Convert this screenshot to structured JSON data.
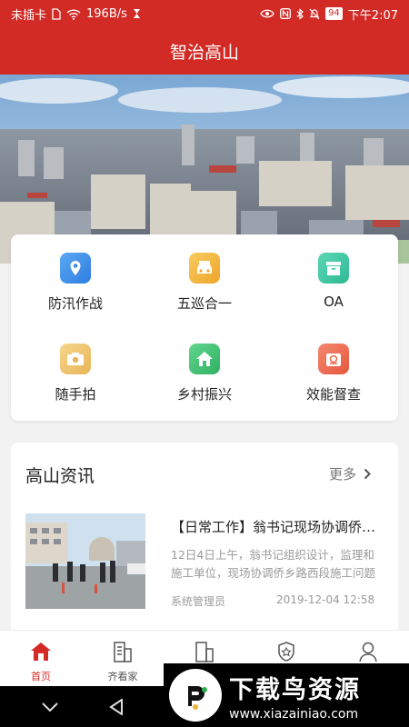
{
  "status_bar": {
    "carrier": "未插卡",
    "speed": "196B/s",
    "battery": "94",
    "time": "下午2:07"
  },
  "header": {
    "title": "智治高山"
  },
  "grid": [
    {
      "label": "防汛作战",
      "icon": "location-pin-icon",
      "color": "#3d8fe8"
    },
    {
      "label": "五巡合一",
      "icon": "car-icon",
      "color": "#f0b335"
    },
    {
      "label": "OA",
      "icon": "archive-box-icon",
      "color": "#37c4a3"
    },
    {
      "label": "随手拍",
      "icon": "camera-icon",
      "color": "#efc46a"
    },
    {
      "label": "乡村振兴",
      "icon": "home-icon",
      "color": "#3fc277"
    },
    {
      "label": "效能督查",
      "icon": "inspect-icon",
      "color": "#ef6a52"
    }
  ],
  "news": {
    "section_title": "高山资讯",
    "more_label": "更多",
    "items": [
      {
        "title": "【日常工作】翁书记现场协调侨乡路西段施工",
        "summary": "12日4日上午，翁书记组织设计，监理和施工单位，现场协调侨乡路西段施工问题",
        "author": "系统管理员",
        "date": "2019-12-04 12:58"
      }
    ]
  },
  "tabs": [
    {
      "label": "首页",
      "icon": "home-icon"
    },
    {
      "label": "齐看家",
      "icon": "building-icon"
    },
    {
      "label": "",
      "icon": "building-icon"
    },
    {
      "label": "",
      "icon": "badge-icon"
    },
    {
      "label": "",
      "icon": "user-icon"
    }
  ],
  "watermark": {
    "name": "下载鸟资源",
    "url": "www.xiazainiao.com"
  },
  "colors": {
    "brand": "#d22b26"
  }
}
